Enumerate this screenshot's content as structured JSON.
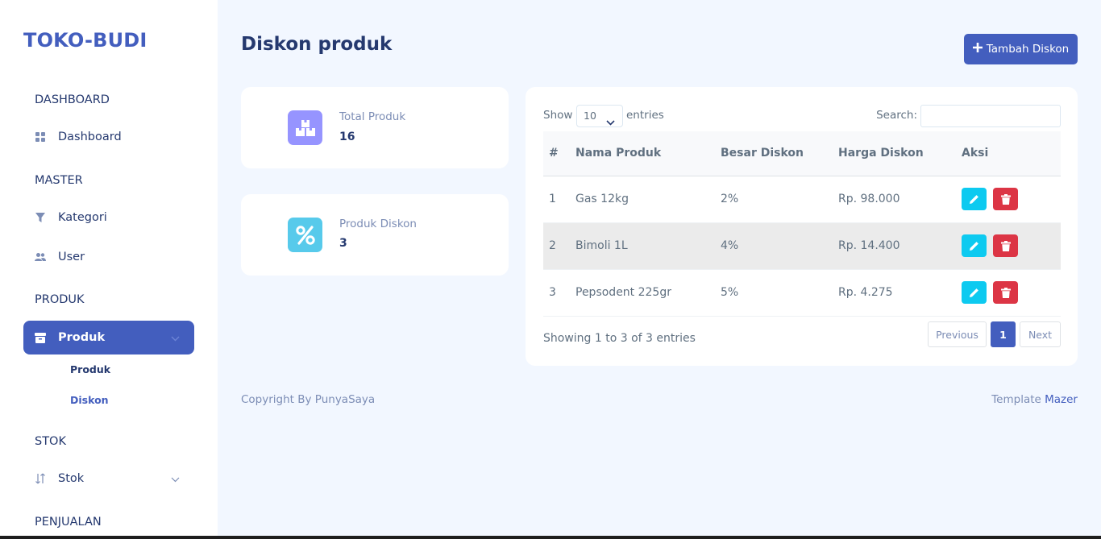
{
  "sidebar": {
    "brand": "TOKO-BUDI",
    "sections": {
      "dashboard": "DASHBOARD",
      "master": "MASTER",
      "produk": "PRODUK",
      "stok": "STOK",
      "penjualan": "PENJUALAN"
    },
    "items": {
      "dashboard": "Dashboard",
      "kategori": "Kategori",
      "user": "User",
      "produk": "Produk",
      "stok": "Stok"
    },
    "submenu": {
      "produk": "Produk",
      "diskon": "Diskon"
    }
  },
  "header": {
    "title": "Diskon produk",
    "add_button": "Tambah Diskon"
  },
  "stats": {
    "total_label": "Total Produk",
    "total_value": "16",
    "diskon_label": "Produk Diskon",
    "diskon_value": "3"
  },
  "table": {
    "show_label": "Show",
    "page_size": "10",
    "entries_label": "entries",
    "search_label": "Search:",
    "columns": [
      "#",
      "Nama Produk",
      "Besar Diskon",
      "Harga Diskon",
      "Aksi"
    ],
    "rows": [
      {
        "no": "1",
        "nama": "Gas 12kg",
        "diskon": "2%",
        "harga": "Rp. 98.000"
      },
      {
        "no": "2",
        "nama": "Bimoli 1L",
        "diskon": "4%",
        "harga": "Rp. 14.400"
      },
      {
        "no": "3",
        "nama": "Pepsodent 225gr",
        "diskon": "5%",
        "harga": "Rp. 4.275"
      }
    ],
    "info": "Showing 1 to 3 of 3 entries",
    "pager": {
      "previous": "Previous",
      "page": "1",
      "next": "Next"
    }
  },
  "footer": {
    "copyright": "Copyright By PunyaSaya",
    "template_prefix": "Template",
    "template_link": "Mazer"
  },
  "colors": {
    "primary": "#435ebe",
    "edit": "#0dcaf0",
    "delete": "#dc3545",
    "icon_purple": "#9694ff",
    "icon_blue": "#57caeb"
  }
}
